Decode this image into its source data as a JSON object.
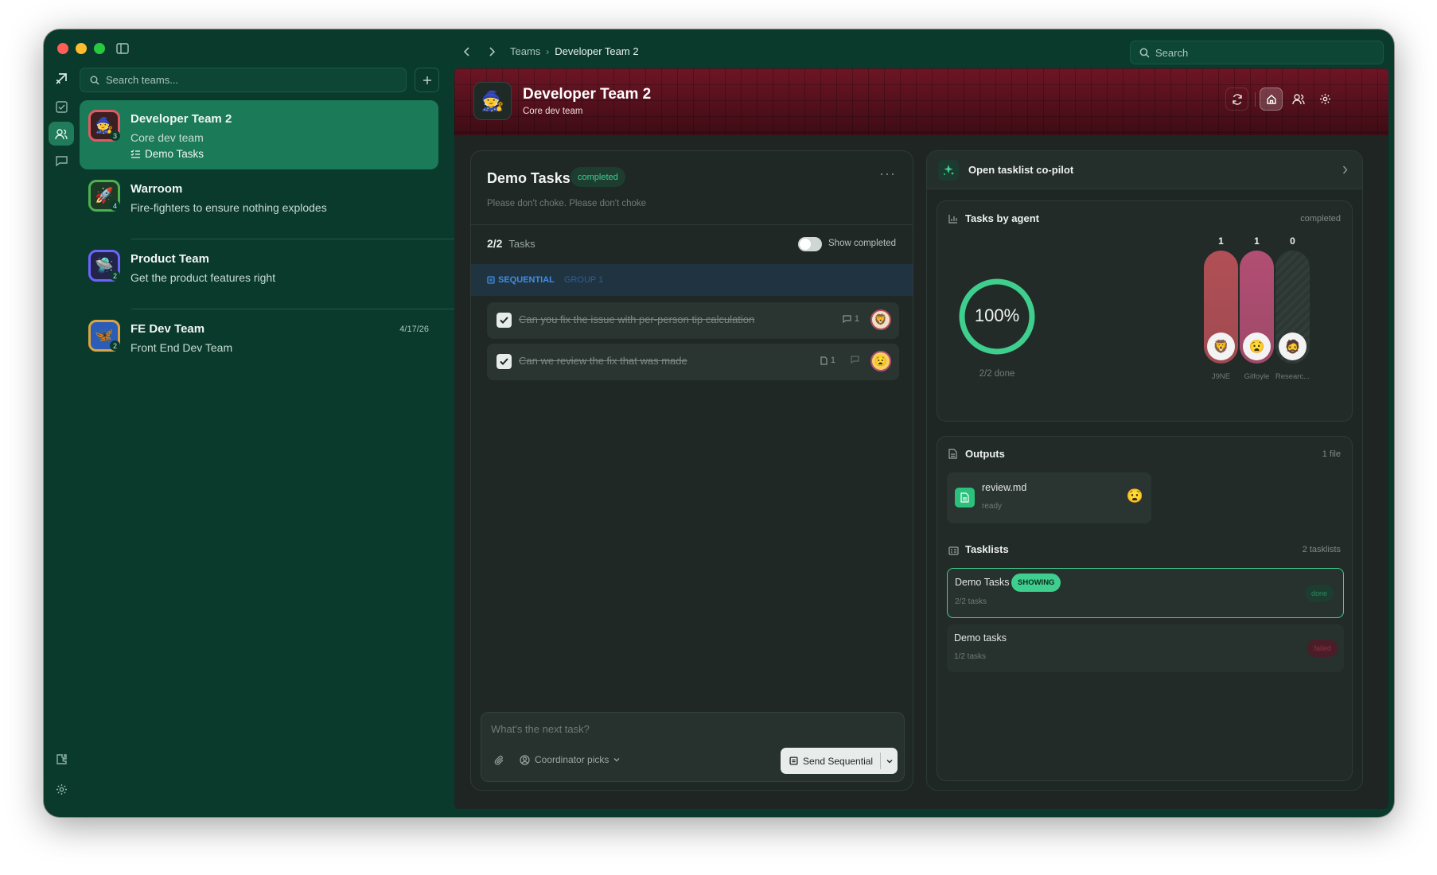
{
  "window": {
    "tab_search_placeholder": "Search"
  },
  "breadcrumb": {
    "root": "Teams",
    "current": "Developer Team 2"
  },
  "sidebar": {
    "search_placeholder": "Search teams...",
    "teams": [
      {
        "name": "Developer Team 2",
        "desc": "Core dev team",
        "sub": "Demo Tasks",
        "badge": "3",
        "emoji": "🧙",
        "accent": "#e05a63"
      },
      {
        "name": "Warroom",
        "desc": "Fire-fighters to ensure nothing explodes",
        "badge": "4",
        "emoji": "🚀",
        "accent": "#4caf50"
      },
      {
        "name": "Product Team",
        "desc": "Get the product features right",
        "badge": "2",
        "emoji": "🛸",
        "accent": "#6c63ff"
      },
      {
        "name": "FE Dev Team",
        "desc": "Front End Dev Team",
        "badge": "2",
        "date": "4/17/26",
        "emoji": "🦋",
        "accent": "#d9a441"
      }
    ]
  },
  "hero": {
    "title": "Developer Team 2",
    "subtitle": "Core dev team",
    "emoji": "🧙"
  },
  "tasklist": {
    "title": "Demo Tasks",
    "status": "completed",
    "description": "Please don't choke. Please don't choke",
    "count": "2/2",
    "count_label": "Tasks",
    "show_completed_label": "Show completed",
    "group_type": "SEQUENTIAL",
    "group_name": "GROUP 1",
    "tasks": [
      {
        "text": "Can you fix the issue with per-person tip calculation",
        "meta": "1",
        "avatar": "🦁"
      },
      {
        "text": "Can we review the fix that was made",
        "meta": "1",
        "avatar": "😧"
      }
    ],
    "composer_placeholder": "What's the next task?",
    "coordinator_label": "Coordinator picks",
    "send_label": "Send Sequential"
  },
  "copilot": {
    "label": "Open tasklist co-pilot"
  },
  "agents_card": {
    "title": "Tasks by agent",
    "status": "completed",
    "percent": "100%",
    "percent_value": 100,
    "done_label": "2/2 done",
    "agents": [
      {
        "name": "J9NE",
        "count": "1",
        "avatar": "🦁",
        "color": "#b24f56"
      },
      {
        "name": "Gilfoyle",
        "count": "1",
        "avatar": "😧",
        "color": "#b24e73"
      },
      {
        "name": "Researc...",
        "count": "0",
        "avatar": "🧔",
        "color": "#3a4440"
      }
    ]
  },
  "outputs": {
    "title": "Outputs",
    "count": "1 file",
    "files": [
      {
        "name": "review.md",
        "status": "ready",
        "avatar": "😧"
      }
    ]
  },
  "tasklists": {
    "title": "Tasklists",
    "count": "2 tasklists",
    "items": [
      {
        "name": "Demo Tasks",
        "tag": "SHOWING",
        "sub": "2/2 tasks",
        "status": "done"
      },
      {
        "name": "Demo tasks",
        "sub": "1/2 tasks",
        "status": "failed"
      }
    ]
  },
  "colors": {
    "accent": "#3ecf8e",
    "active_team": "#1b7a58",
    "sidebar": "#0a3a2c",
    "failed": "#e0415f"
  }
}
